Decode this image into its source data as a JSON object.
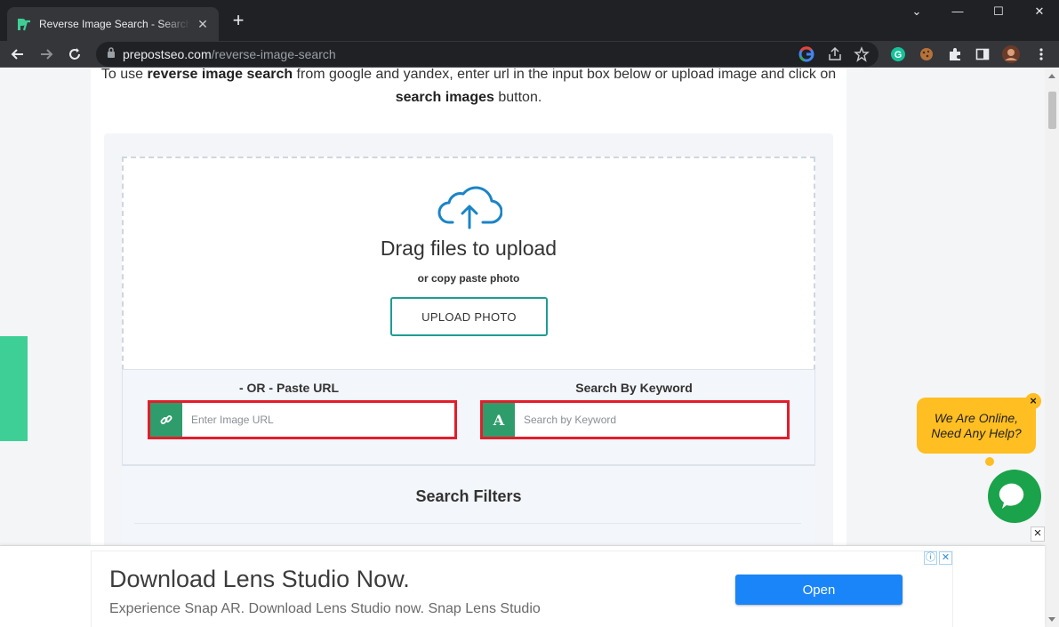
{
  "browser": {
    "tab_title": "Reverse Image Search - Search By Image",
    "tab_close": "✕",
    "new_tab": "+",
    "url_host": "prepostseo.com",
    "url_path": "/reverse-image-search",
    "win_minimize": "⌄",
    "win_min": "—",
    "win_max": "☐",
    "win_close": "✕"
  },
  "intro": {
    "prefix": "To use ",
    "bold1": "reverse image search",
    "middle": " from google and yandex, enter url in the input box below or upload image and click on",
    "bold2": "search images",
    "suffix": " button."
  },
  "upload": {
    "title": "Drag files to upload",
    "subtitle": "or copy paste photo",
    "button": "UPLOAD PHOTO"
  },
  "url_search": {
    "label": "- OR - Paste URL",
    "placeholder": "Enter Image URL"
  },
  "keyword_search": {
    "label": "Search By Keyword",
    "icon_letter": "A",
    "placeholder": "Search by Keyword"
  },
  "filters": {
    "title": "Search Filters"
  },
  "chat": {
    "line1": "We Are Online,",
    "line2": "Need Any Help?",
    "close": "×"
  },
  "ad": {
    "title": "Download Lens Studio Now.",
    "subtitle": "Experience Snap AR. Download Lens Studio now. Snap Lens Studio",
    "button": "Open",
    "close": "×",
    "info": "ⓘ",
    "x": "✕"
  },
  "colors": {
    "accent_teal": "#1e9c93",
    "highlight_red": "#e41d2a",
    "icon_green": "#2e9d6b",
    "chat_yellow": "#ffbe21",
    "chat_green": "#1aa34a",
    "ad_blue": "#1a85f8"
  }
}
